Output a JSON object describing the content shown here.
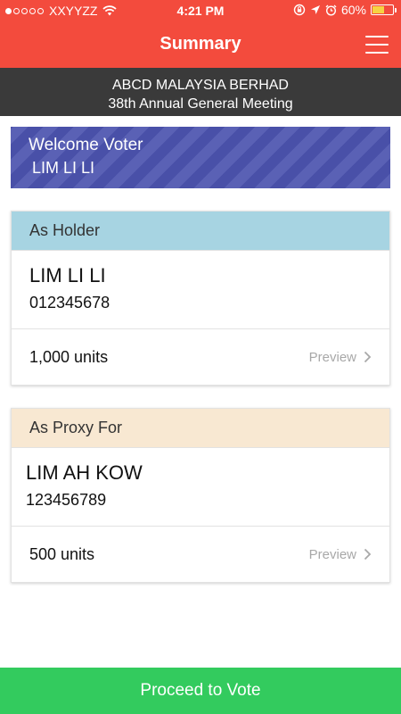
{
  "status_bar": {
    "carrier": "XXYYZZ",
    "signal_bars": "1 of 5",
    "time": "4:21 PM",
    "battery": "60%",
    "battery_level": 0.6,
    "battery_color": "#f6d343"
  },
  "header": {
    "title": "Summary",
    "menu_icon": "hamburger-menu-icon",
    "color": "#f34b3d"
  },
  "company": {
    "name": "ABCD MALAYSIA BERHAD",
    "meeting": "38th Annual General Meeting"
  },
  "welcome": {
    "title": "Welcome Voter",
    "name": "LIM LI LI"
  },
  "holder_card": {
    "header": "As Holder",
    "name": "LIM LI LI",
    "id": "012345678",
    "units": "1,000 units",
    "preview": "Preview",
    "header_color": "#a7d4e2"
  },
  "proxy_card": {
    "header": "As Proxy For",
    "name": "LIM AH KOW",
    "id": "123456789",
    "units": "500 units",
    "preview": "Preview",
    "header_color": "#f8e8d2"
  },
  "footer": {
    "proceed_label": "Proceed to Vote",
    "color": "#33cb5e"
  }
}
